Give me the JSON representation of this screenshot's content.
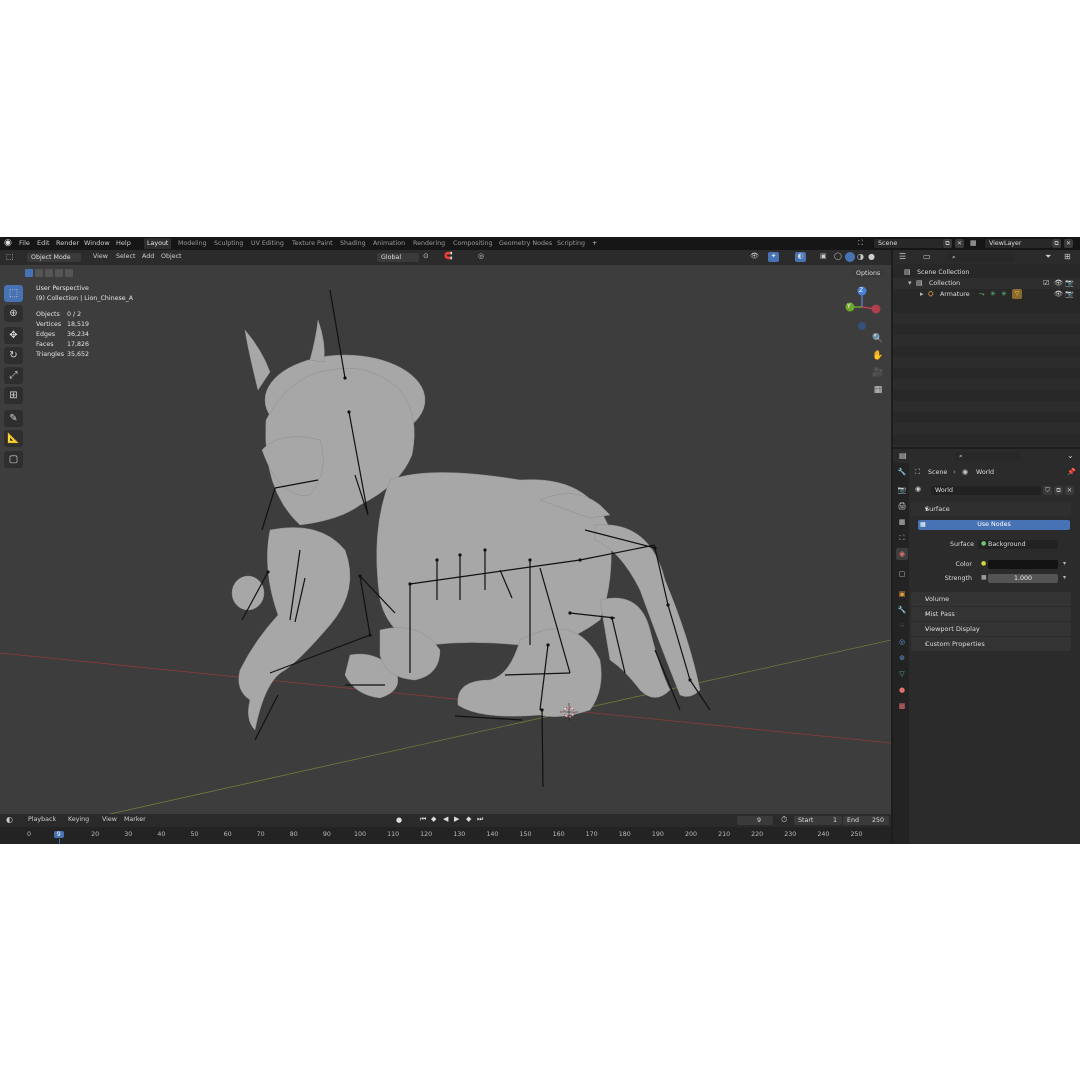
{
  "topbar": {
    "menus": [
      "File",
      "Edit",
      "Render",
      "Window",
      "Help"
    ],
    "workspace_tabs": [
      "Layout",
      "Modeling",
      "Sculpting",
      "UV Editing",
      "Texture Paint",
      "Shading",
      "Animation",
      "Rendering",
      "Compositing",
      "Geometry Nodes",
      "Scripting"
    ],
    "active_tab": "Layout",
    "add_tab": "+",
    "scene_name": "Scene",
    "view_layer": "ViewLayer"
  },
  "viewport": {
    "mode": "Object Mode",
    "menus": [
      "View",
      "Select",
      "Add",
      "Object"
    ],
    "orientation": "Global",
    "options_label": "Options",
    "info": {
      "perspective": "User Perspective",
      "collection": "(9) Collection | Lion_Chinese_A"
    },
    "stats": [
      {
        "label": "Objects",
        "value": "0 / 2"
      },
      {
        "label": "Vertices",
        "value": "18,519"
      },
      {
        "label": "Edges",
        "value": "36,234"
      },
      {
        "label": "Faces",
        "value": "17,826"
      },
      {
        "label": "Triangles",
        "value": "35,652"
      }
    ],
    "gizmo": {
      "x": "X",
      "y": "Y",
      "z": "Z"
    }
  },
  "timeline": {
    "menus": [
      "Playback",
      "Keying",
      "View",
      "Marker"
    ],
    "current_frame": "9",
    "start_label": "Start",
    "start_value": "1",
    "end_label": "End",
    "end_value": "250",
    "ruler": [
      "0",
      "9",
      "20",
      "30",
      "40",
      "50",
      "60",
      "70",
      "80",
      "90",
      "100",
      "110",
      "120",
      "130",
      "140",
      "150",
      "160",
      "170",
      "180",
      "190",
      "200",
      "210",
      "220",
      "230",
      "240",
      "250"
    ]
  },
  "outliner": {
    "rows": [
      {
        "label": "Scene Collection"
      },
      {
        "label": "Collection"
      },
      {
        "label": "Armature"
      }
    ]
  },
  "properties": {
    "breadcrumb_scene": "Scene",
    "breadcrumb_world": "World",
    "world_name": "World",
    "surface_panel": "Surface",
    "use_nodes": "Use Nodes",
    "surface_label": "Surface",
    "surface_value": "Background",
    "color_label": "Color",
    "strength_label": "Strength",
    "strength_value": "1.000",
    "collapsed_panels": [
      "Volume",
      "Mist Pass",
      "Viewport Display",
      "Custom Properties"
    ]
  },
  "colors": {
    "accent": "#4772b3",
    "viewport_bg": "#3d3d3d",
    "mesh": "#a9a9a9"
  }
}
